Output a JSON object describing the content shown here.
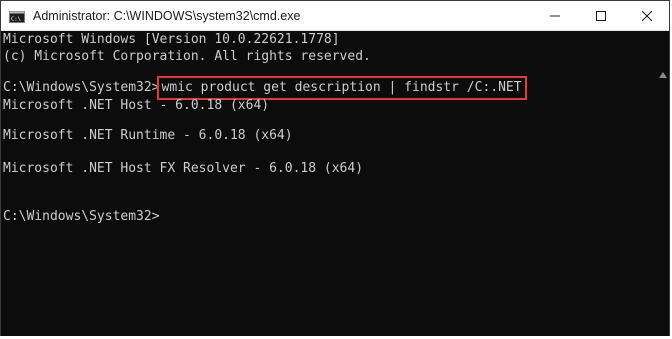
{
  "window": {
    "title": "Administrator: C:\\WINDOWS\\system32\\cmd.exe",
    "icon": "cmd-icon",
    "controls": {
      "minimize": "minimize-icon",
      "maximize": "maximize-icon",
      "close": "close-icon"
    }
  },
  "console": {
    "header_line1": "Microsoft Windows [Version 10.0.22621.1778]",
    "header_line2": "(c) Microsoft Corporation. All rights reserved.",
    "prompt1": "C:\\Windows\\System32>",
    "command": "wmic product get description | findstr /C:.NET",
    "output": [
      "Microsoft .NET Host - 6.0.18 (x64)",
      "Microsoft .NET Runtime - 6.0.18 (x64)",
      "Microsoft .NET Host FX Resolver - 6.0.18 (x64)"
    ],
    "prompt2": "C:\\Windows\\System32>"
  },
  "colors": {
    "console_bg": "#0c0c0c",
    "console_text": "#cccccc",
    "highlight_border": "#e03c3c",
    "titlebar_bg": "#ffffff"
  }
}
